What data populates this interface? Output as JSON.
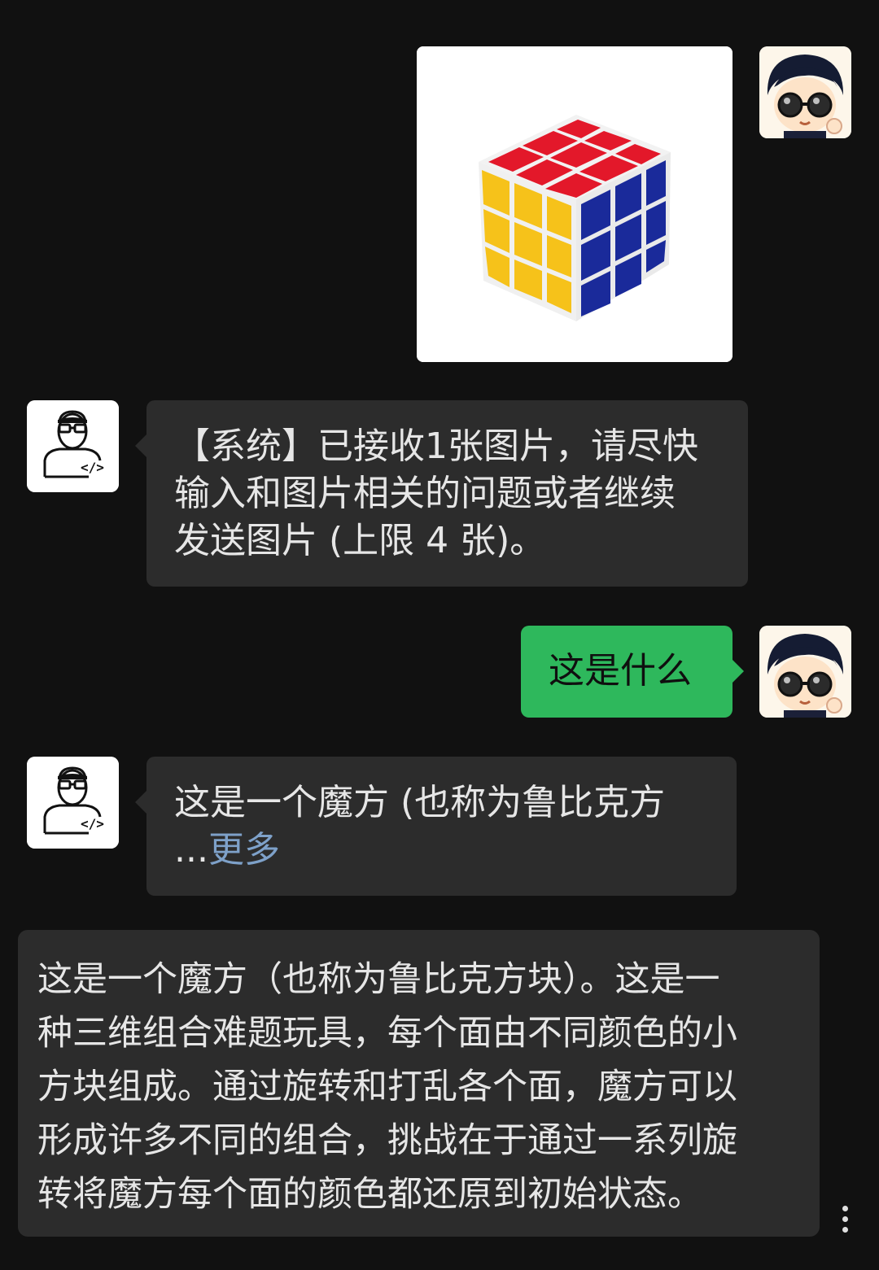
{
  "messages": {
    "image_message": {
      "content": "rubiks-cube-photo"
    },
    "system_reply": {
      "lines": [
        "【系统】已接收1张图片，请尽快",
        "输入和图片相关的问题或者继续",
        "发送图片 (上限 4 张)。"
      ]
    },
    "user_question": {
      "text": "这是什么"
    },
    "bot_answer": {
      "preview_line1": "这是一个魔方 (也称为鲁比克方",
      "ellipsis": "...",
      "more_label": "更多"
    }
  },
  "expanded_answer": {
    "lines": [
      "这是一个魔方（也称为鲁比克方块）。这是一",
      "种三维组合难题玩具，每个面由不同颜色的小",
      "方块组成。通过旋转和打乱各个面，魔方可以",
      "形成许多不同的组合，挑战在于通过一系列旋",
      "转将魔方每个面的颜色都还原到初始状态。"
    ]
  },
  "colors": {
    "background": "#111111",
    "bubble_bg": "#2c2c2c",
    "user_bubble": "#2eb85c",
    "link": "#7ea1c9"
  },
  "icons": {
    "user_avatar": "cartoon-boy-sunglasses-avatar",
    "bot_avatar": "developer-avatar-icon",
    "menu": "more-vertical-icon"
  }
}
